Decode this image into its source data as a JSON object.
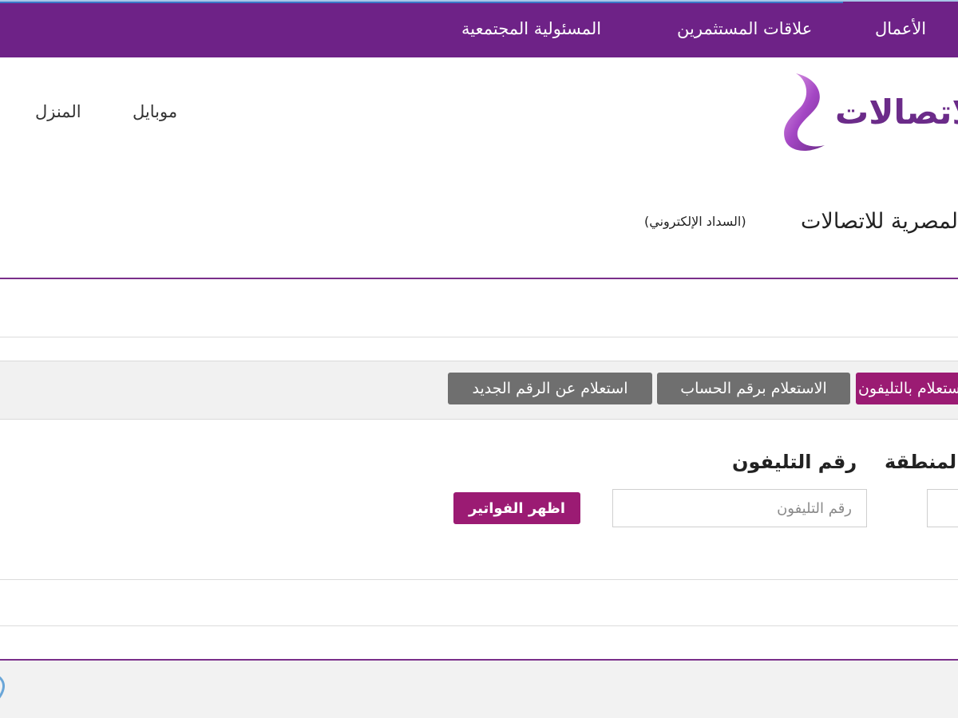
{
  "top_nav": {
    "items": [
      {
        "label": "الأعمال"
      },
      {
        "label": "علاقات المستثمرين"
      },
      {
        "label": "المسئولية المجتمعية"
      }
    ]
  },
  "brand": {
    "logo_text": "للاتصالات",
    "color": "#6b2b89"
  },
  "main_nav": {
    "items": [
      {
        "label": "موبايل"
      },
      {
        "label": "المنزل"
      }
    ]
  },
  "page": {
    "heading": "المصرية للاتصالات",
    "subtitle": "(السداد الإلكتروني)"
  },
  "tabs": [
    {
      "label": "الاستعلام بالتليفون",
      "active": true
    },
    {
      "label": "الاستعلام برقم الحساب",
      "active": false
    },
    {
      "label": "استعلام عن الرقم الجديد",
      "active": false
    }
  ],
  "form": {
    "area_label": "المنطقة",
    "phone_label": "رقم التليفون",
    "phone_value": "",
    "phone_placeholder": "رقم التليفون",
    "submit_label": "اظهر الفواتير"
  },
  "colors": {
    "top_bar": "#6e2287",
    "accent_button": "#9b1b73",
    "tab_inactive": "#6f6f6f"
  }
}
